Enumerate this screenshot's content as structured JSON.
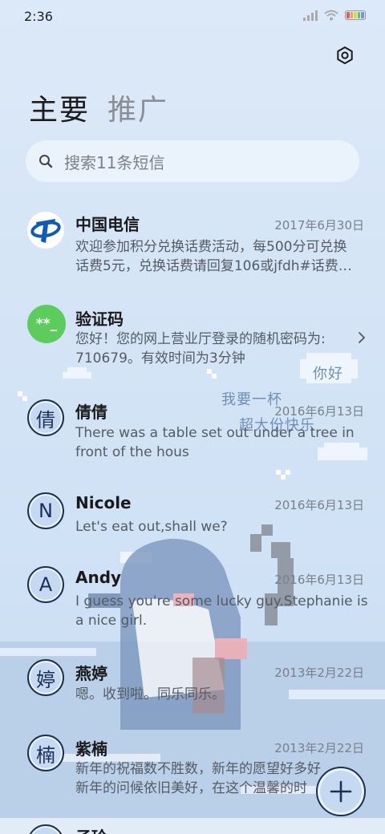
{
  "status_bar": {
    "time": "2:36",
    "battery_colors": [
      "#e35a5a",
      "#e8a54a",
      "#e8d44a",
      "#6ac06a",
      "#6a9ae0"
    ]
  },
  "header": {
    "tab_main": "主要",
    "tab_promo": "推广"
  },
  "search": {
    "placeholder": "搜索11条短信"
  },
  "decorations": {
    "bubble_1": "你好",
    "bubble_2a": "我要一杯",
    "bubble_2b": "超大份快乐"
  },
  "messages": [
    {
      "sender": "中国电信",
      "date": "2017年6月30日",
      "line1": "欢迎参加积分兑换话费活动，每500分可兑换",
      "line2": "话费5元，兑换话费请回复106或jfdh#话费…"
    },
    {
      "sender": "验证码",
      "avatar": "**_",
      "line1": "您好！您的网上营业厅登录的随机密码为:",
      "line2": "710679。有效时间为3分钟"
    },
    {
      "sender": "倩倩",
      "avatar": "倩",
      "date": "2016年6月13日",
      "line1": "There was a table set out under a tree in",
      "line2": "front of the hous"
    },
    {
      "sender": "Nicole",
      "avatar": "N",
      "date": "2016年6月13日",
      "line1": "Let's eat out,shall we?"
    },
    {
      "sender": "Andy",
      "avatar": "A",
      "date": "2016年6月13日",
      "line1": "I guess you're some lucky guy.Stephanie is",
      "line2": "a nice girl."
    },
    {
      "sender": "燕婷",
      "avatar": "婷",
      "date": "2013年2月22日",
      "line1": "嗯。收到啦。同乐同乐。"
    },
    {
      "sender": "紫楠",
      "avatar": "楠",
      "date": "2013年2月22日",
      "line1": "新年的祝福数不胜数，新年的愿望好多好",
      "line2": "新年的问候依旧美好，在这个温馨的时"
    },
    {
      "sender": "子玲"
    }
  ],
  "colors": {
    "accent": "#1d2f55",
    "avatar_fill": "#c6d9f2",
    "telecom_blue": "#0e5bb5",
    "verify_green": "#5ccc5c"
  }
}
